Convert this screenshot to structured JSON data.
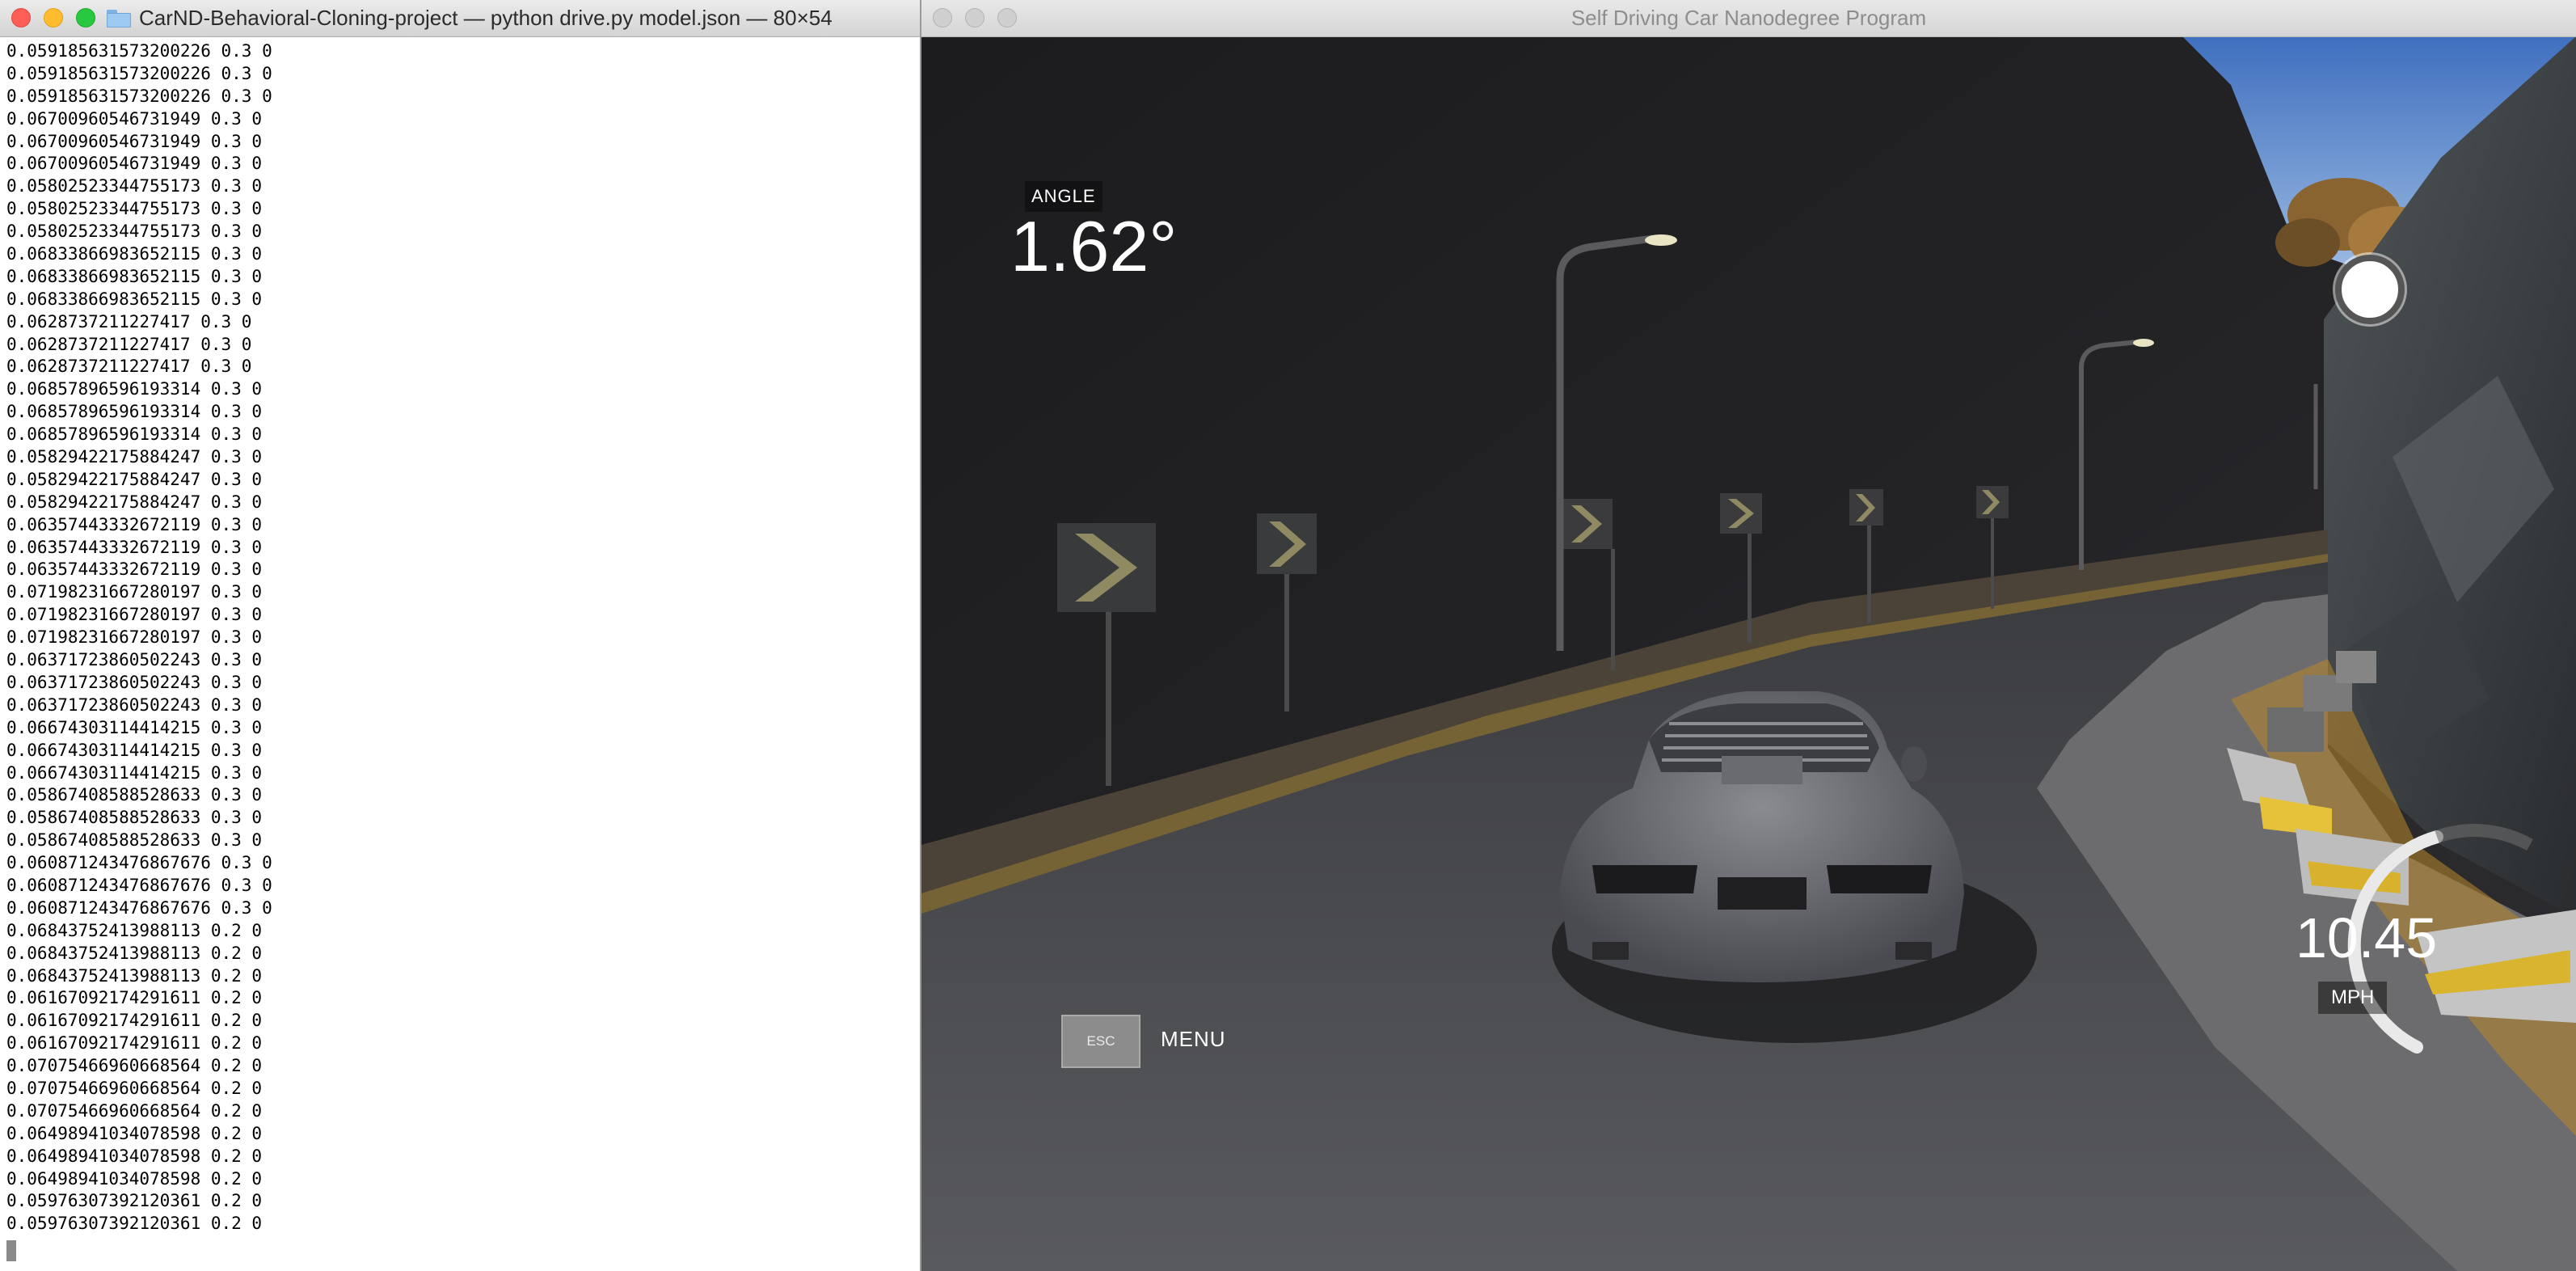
{
  "terminal": {
    "title": "CarND-Behavioral-Cloning-project — python drive.py model.json — 80×54",
    "lines": [
      "0.059185631573200226 0.3 0",
      "0.059185631573200226 0.3 0",
      "0.059185631573200226 0.3 0",
      "0.06700960546731949 0.3 0",
      "0.06700960546731949 0.3 0",
      "0.06700960546731949 0.3 0",
      "0.05802523344755173 0.3 0",
      "0.05802523344755173 0.3 0",
      "0.05802523344755173 0.3 0",
      "0.06833866983652115 0.3 0",
      "0.06833866983652115 0.3 0",
      "0.06833866983652115 0.3 0",
      "0.0628737211227417 0.3 0",
      "0.0628737211227417 0.3 0",
      "0.0628737211227417 0.3 0",
      "0.06857896596193314 0.3 0",
      "0.06857896596193314 0.3 0",
      "0.06857896596193314 0.3 0",
      "0.05829422175884247 0.3 0",
      "0.05829422175884247 0.3 0",
      "0.05829422175884247 0.3 0",
      "0.06357443332672119 0.3 0",
      "0.06357443332672119 0.3 0",
      "0.06357443332672119 0.3 0",
      "0.07198231667280197 0.3 0",
      "0.07198231667280197 0.3 0",
      "0.07198231667280197 0.3 0",
      "0.06371723860502243 0.3 0",
      "0.06371723860502243 0.3 0",
      "0.06371723860502243 0.3 0",
      "0.06674303114414215 0.3 0",
      "0.06674303114414215 0.3 0",
      "0.06674303114414215 0.3 0",
      "0.05867408588528633 0.3 0",
      "0.05867408588528633 0.3 0",
      "0.05867408588528633 0.3 0",
      "0.060871243476867676 0.3 0",
      "0.060871243476867676 0.3 0",
      "0.060871243476867676 0.3 0",
      "0.06843752413988113 0.2 0",
      "0.06843752413988113 0.2 0",
      "0.06843752413988113 0.2 0",
      "0.06167092174291611 0.2 0",
      "0.06167092174291611 0.2 0",
      "0.06167092174291611 0.2 0",
      "0.07075466960668564 0.2 0",
      "0.07075466960668564 0.2 0",
      "0.07075466960668564 0.2 0",
      "0.06498941034078598 0.2 0",
      "0.06498941034078598 0.2 0",
      "0.06498941034078598 0.2 0",
      "0.05976307392120361 0.2 0",
      "0.05976307392120361 0.2 0"
    ]
  },
  "simulator": {
    "title": "Self Driving Car Nanodegree Program",
    "angle_label": "ANGLE",
    "angle_value": "1.62°",
    "esc_label": "ESC",
    "menu_label": "MENU",
    "speed_value": "10.45",
    "speed_unit": "MPH",
    "speed_fraction": 0.35
  }
}
